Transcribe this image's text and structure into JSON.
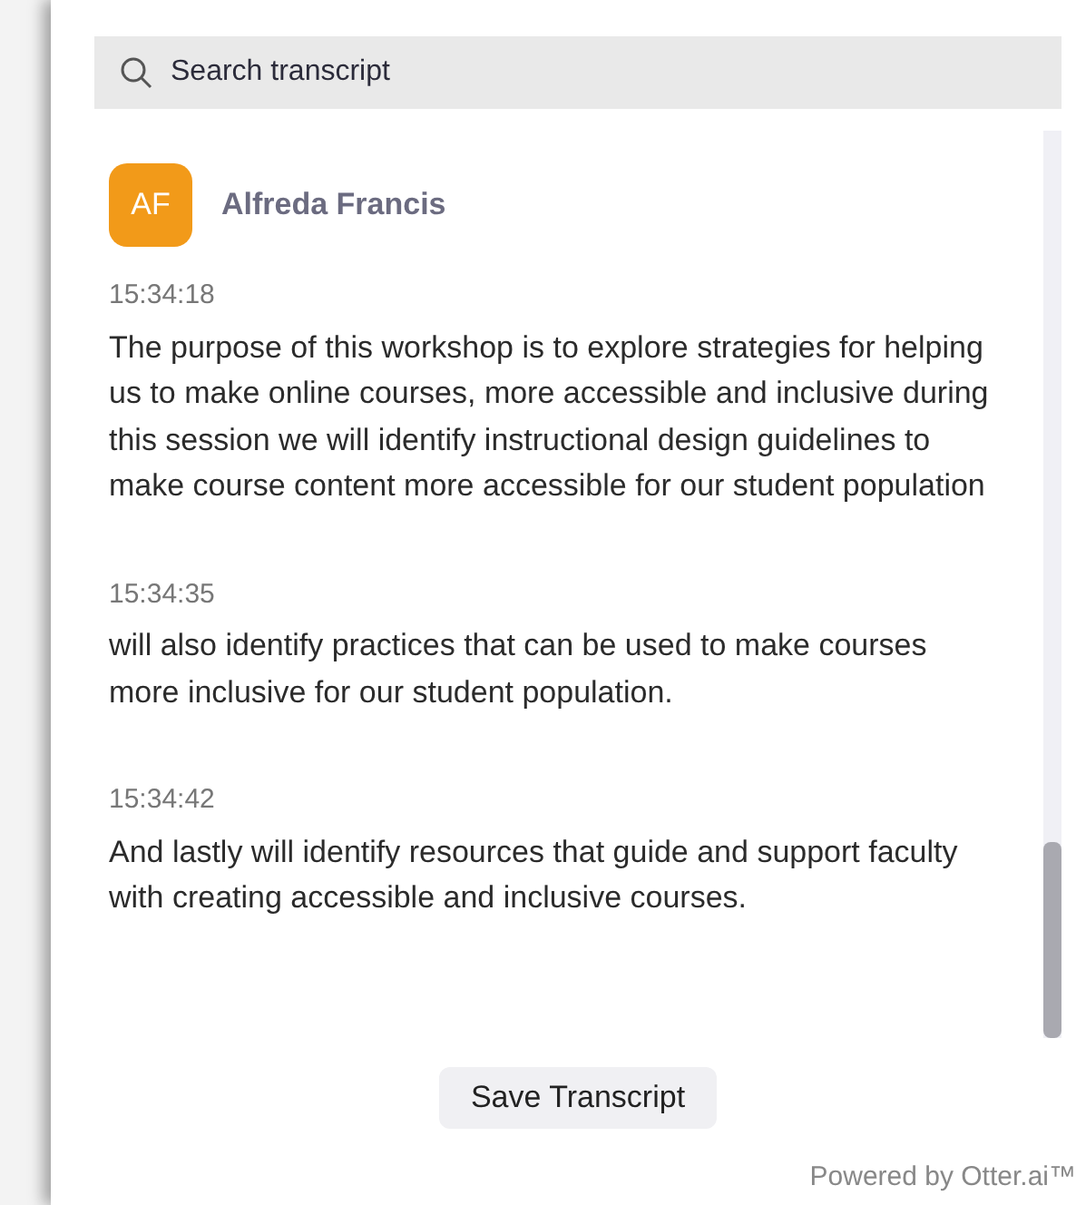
{
  "search": {
    "placeholder": "Search transcript"
  },
  "speaker": {
    "initials": "AF",
    "name": "Alfreda Francis",
    "color": "#f29a19"
  },
  "entries": [
    {
      "time": "15:34:18",
      "text": "The purpose of this workshop is to explore strategies for helping us to make online courses, more accessible and inclusive during this session we will identify instructional design guidelines to make course content more accessible for our student population"
    },
    {
      "time": "15:34:35",
      "text": "will also identify practices that can be used to make courses more inclusive for our student population."
    },
    {
      "time": "15:34:42",
      "text": "And lastly will identify resources that guide and support faculty with creating accessible and inclusive courses."
    }
  ],
  "save_button": "Save Transcript",
  "footer": "Powered by Otter.ai™"
}
